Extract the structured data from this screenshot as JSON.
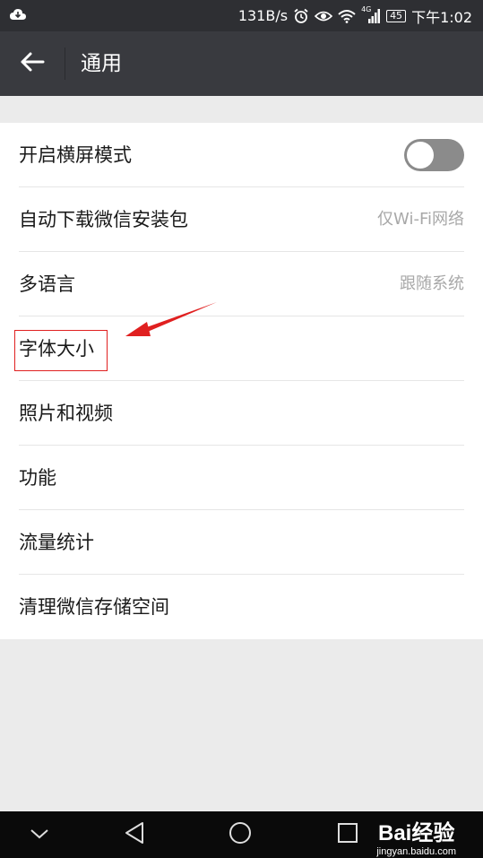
{
  "status_bar": {
    "network_speed": "131B/s",
    "network_type": "4G",
    "battery": "45",
    "time": "下午1:02",
    "icons": [
      "cloud-icon",
      "alarm-icon",
      "eye-icon",
      "wifi-icon",
      "signal-icon",
      "battery-icon"
    ]
  },
  "header": {
    "title": "通用",
    "back_icon": "back-arrow-icon"
  },
  "settings": {
    "items": [
      {
        "label": "开启横屏模式",
        "toggle_on": false
      },
      {
        "label": "自动下载微信安装包",
        "value": "仅Wi-Fi网络"
      },
      {
        "label": "多语言",
        "value": "跟随系统"
      },
      {
        "label": "字体大小",
        "highlighted": true
      },
      {
        "label": "照片和视频"
      },
      {
        "label": "功能"
      },
      {
        "label": "流量统计"
      },
      {
        "label": "清理微信存储空间"
      }
    ]
  },
  "annotation": {
    "arrow_color": "#e02020",
    "box_color": "#e02020"
  },
  "nav_bar": {
    "icons": [
      "chevron-down-icon",
      "back-triangle-icon",
      "home-circle-icon",
      "recents-square-icon"
    ]
  },
  "watermark": {
    "logo_text": "Bai经验",
    "url": "jingyan.baidu.com"
  },
  "colors": {
    "status_bar": "#2e2f33",
    "title_bar": "#393a3f",
    "background": "#ebebeb",
    "toggle_off": "#8b8b8b"
  }
}
